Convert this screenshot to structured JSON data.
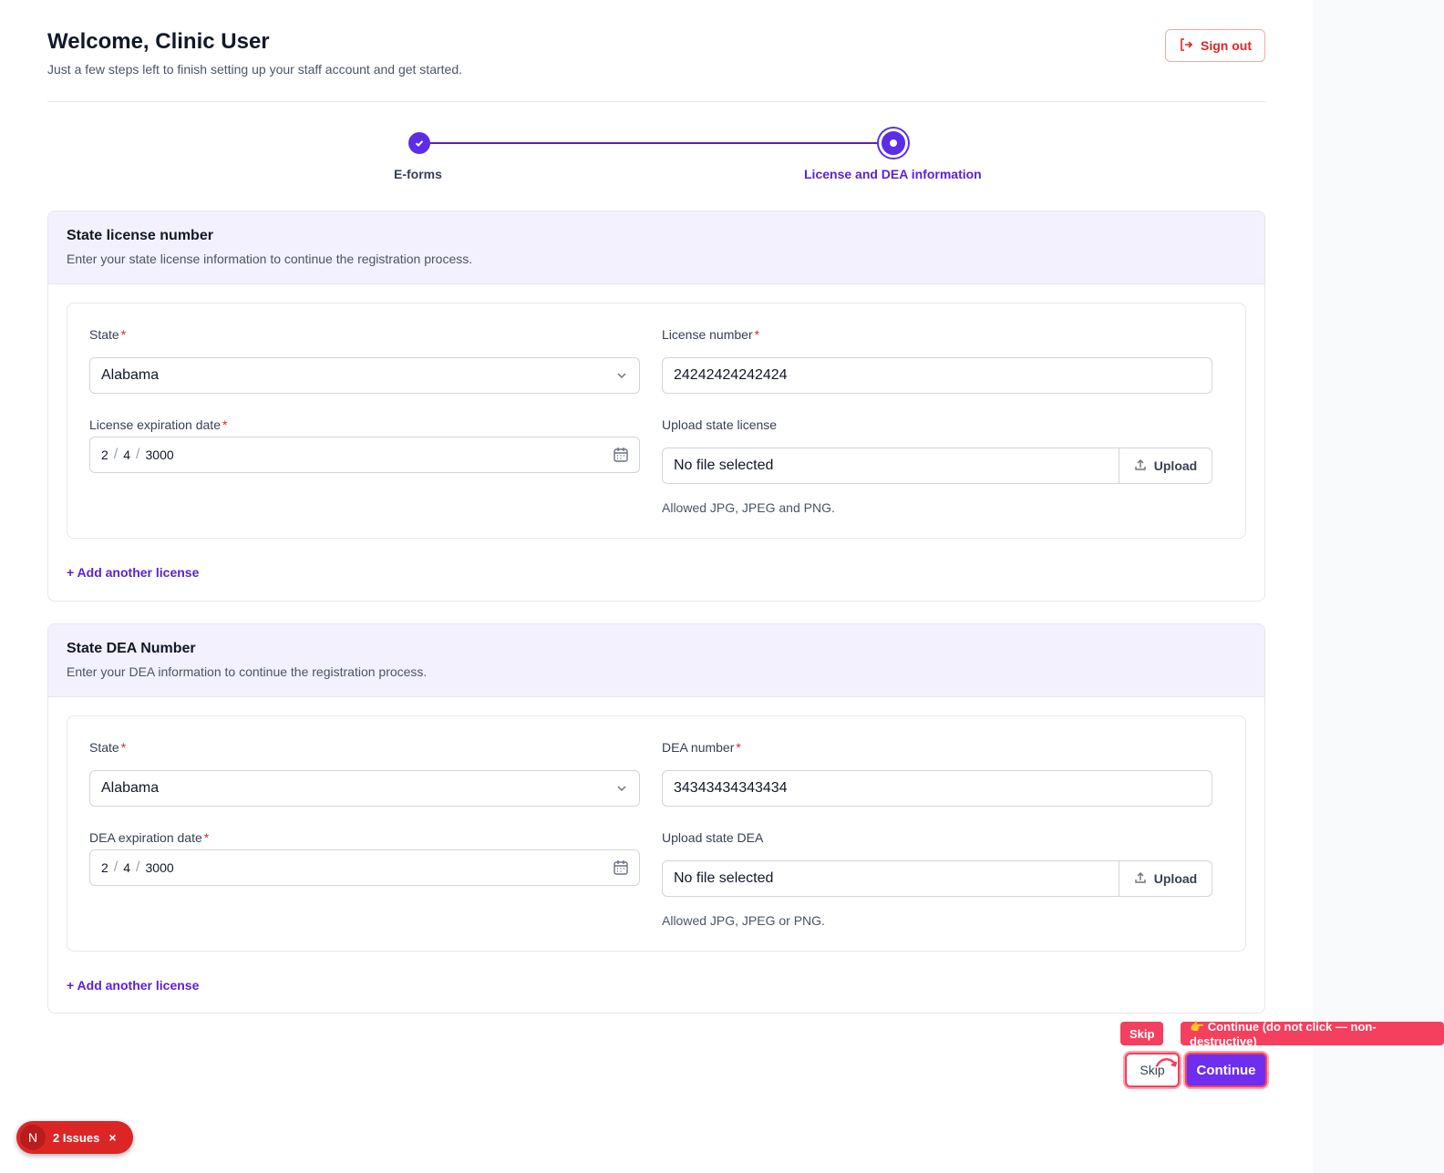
{
  "header": {
    "title": "Welcome, Clinic User",
    "subtitle": "Just a few steps left to finish setting up your staff account and get started.",
    "signout_label": "Sign out"
  },
  "stepper": {
    "steps": [
      {
        "label": "E-forms",
        "status": "complete"
      },
      {
        "label": "License and DEA information",
        "status": "active"
      }
    ]
  },
  "license_section": {
    "title": "State license number",
    "description": "Enter your state license information to continue the registration process.",
    "state_label": "State",
    "state_value": "Alabama",
    "number_label": "License number",
    "number_value": "24242424242424",
    "expiration_label": "License expiration date",
    "expiration": {
      "month": "2",
      "day": "4",
      "year": "3000"
    },
    "upload_label": "Upload state license",
    "upload_value": "No file selected",
    "upload_button": "Upload",
    "upload_hint": "Allowed JPG, JPEG and PNG.",
    "add_link": "+ Add another license"
  },
  "dea_section": {
    "title": "State DEA Number",
    "description": "Enter your DEA information to continue the registration process.",
    "state_label": "State",
    "state_value": "Alabama",
    "number_label": "DEA number",
    "number_value": "34343434343434",
    "expiration_label": "DEA expiration date",
    "expiration": {
      "month": "2",
      "day": "4",
      "year": "3000"
    },
    "upload_label": "Upload state DEA",
    "upload_value": "No file selected",
    "upload_button": "Upload",
    "upload_hint": "Allowed JPG, JPEG or PNG.",
    "add_link": "+ Add another license"
  },
  "required_mark": "*",
  "date_separator": "/",
  "footer": {
    "skip_label": "Skip",
    "continue_label": "Continue"
  },
  "annotations": {
    "skip_tag": "Skip",
    "continue_tag": "👉 Continue (do not click — non-destructive)"
  },
  "issues_badge": {
    "avatar_letter": "N",
    "label": "2 Issues",
    "close": "×"
  },
  "colors": {
    "accent": "#5b2ee6",
    "danger": "#dc2626",
    "annotation": "#f43f5e",
    "section_header_bg": "#f3f1fd"
  }
}
